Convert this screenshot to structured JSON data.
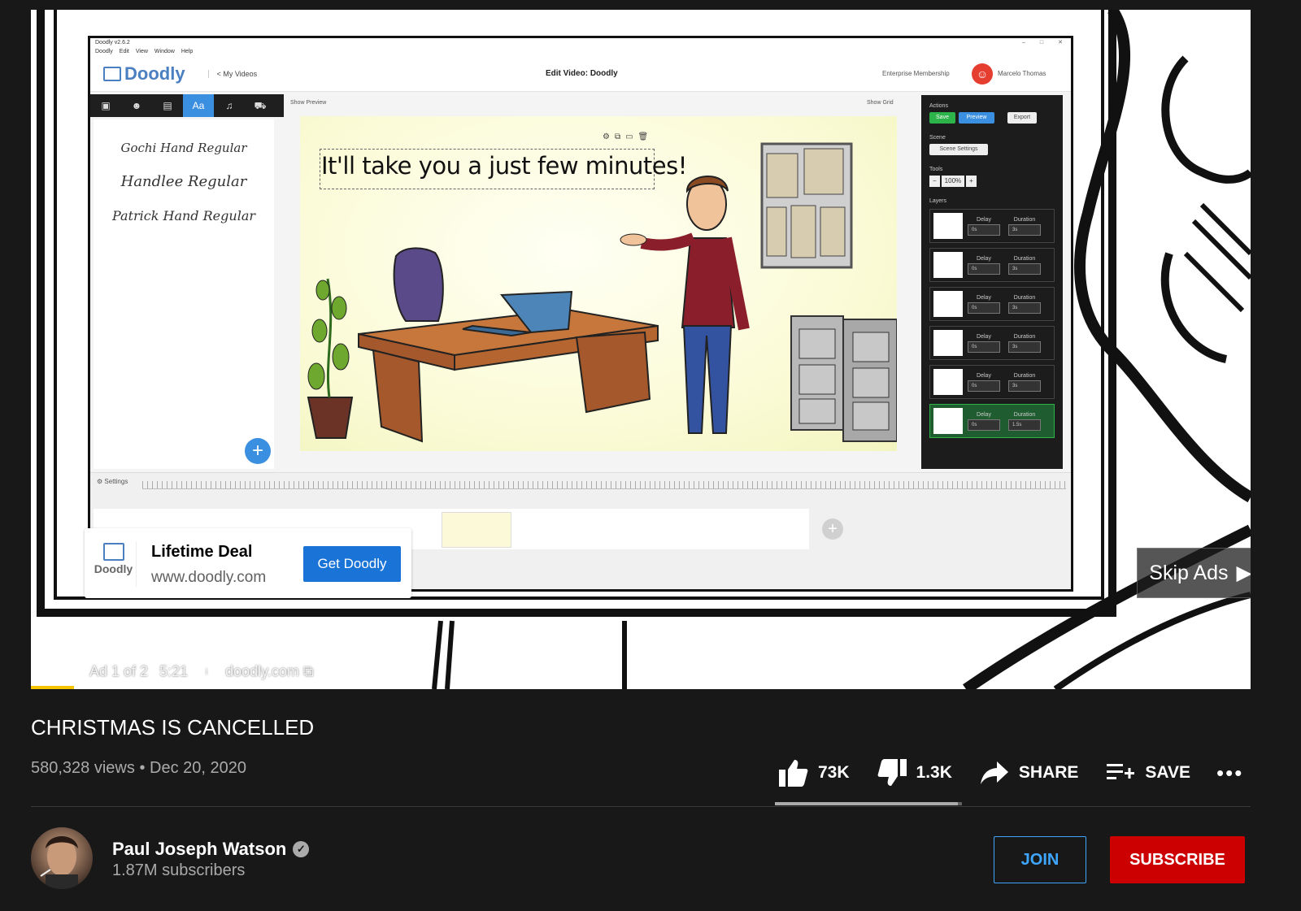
{
  "app": {
    "window_title": "Doodly v2.6.2",
    "menu": [
      "Doodly",
      "Edit",
      "View",
      "Window",
      "Help"
    ],
    "logo_text": "Doodly",
    "my_videos": "< My Videos",
    "edit_title": "Edit Video: Doodly",
    "membership": "Enterprise Membership",
    "user_name": "Marcelo Thomas",
    "show_preview": "Show Preview",
    "show_grid": "Show Grid",
    "fonts": [
      "Gochi Hand Regular",
      "Handlee Regular",
      "Patrick Hand Regular"
    ],
    "canvas_text": "It'll take you a just few minutes!",
    "panel": {
      "actions_label": "Actions",
      "save": "Save",
      "preview": "Preview",
      "export": "Export",
      "scene_label": "Scene",
      "scene_settings": "Scene Settings",
      "tools_label": "Tools",
      "zoom": "100%",
      "layers_label": "Layers",
      "delay_label": "Delay",
      "duration_label": "Duration",
      "layers": [
        {
          "delay": "0s",
          "duration": "3s"
        },
        {
          "delay": "0s",
          "duration": "3s"
        },
        {
          "delay": "0s",
          "duration": "3s"
        },
        {
          "delay": "0s",
          "duration": "3s"
        },
        {
          "delay": "0s",
          "duration": "3s"
        },
        {
          "delay": "0s",
          "duration": "1.5s"
        }
      ]
    },
    "timeline_settings": "Settings"
  },
  "ad": {
    "logo_text": "Doodly",
    "title": "Lifetime Deal",
    "url": "www.doodly.com",
    "cta": "Get Doodly",
    "skip": "Skip Ads",
    "info_count": "Ad 1 of 2",
    "info_time": "5:21",
    "info_domain": "doodly.com",
    "progress": 0.035
  },
  "video": {
    "title": "CHRISTMAS IS CANCELLED",
    "views": "580,328 views",
    "date": "Dec 20, 2020",
    "likes": "73K",
    "dislikes": "1.3K",
    "share": "SHARE",
    "save": "SAVE",
    "like_ratio": 0.98
  },
  "channel": {
    "name": "Paul Joseph Watson",
    "subscribers": "1.87M subscribers",
    "join": "JOIN",
    "subscribe": "SUBSCRIBE"
  },
  "colors": {
    "accent_yellow": "#f5c400",
    "subscribe_red": "#cc0000",
    "join_blue": "#3ea6ff",
    "doodly_blue": "#4a7fc1"
  }
}
